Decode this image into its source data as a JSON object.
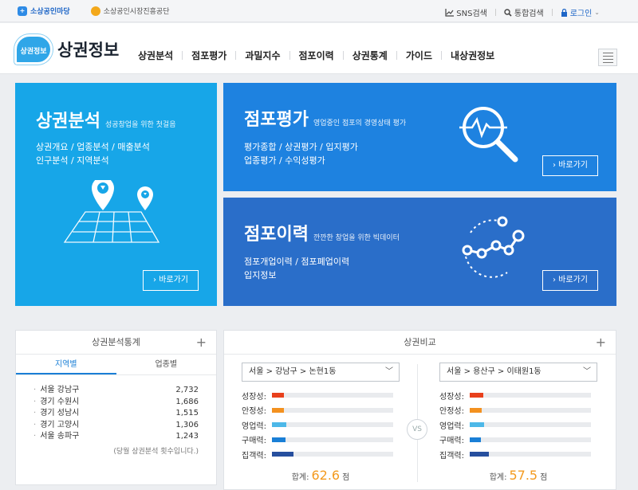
{
  "topbar": {
    "site1": "소상공인마당",
    "site2": "소상공인시장진흥공단",
    "sns": "SNS검색",
    "search": "통합검색",
    "login": "로그인"
  },
  "header": {
    "badge": "상권정보",
    "title": "상권정보",
    "nav": [
      "상권분석",
      "점포평가",
      "과밀지수",
      "점포이력",
      "상권통계",
      "가이드",
      "내상권정보"
    ]
  },
  "cards": {
    "analysis": {
      "title": "상권분석",
      "sub": "성공창업을 위한 첫걸음",
      "line1": "상권개요 / 업종분석 / 매출분석",
      "line2": "인구분석 / 지역분석",
      "go": "› 바로가기"
    },
    "evaluation": {
      "title": "점포평가",
      "sub": "영업중인 점포의 경영상태 평가",
      "line1": "평가종합 / 상권평가 / 입지평가",
      "line2": "업종평가 / 수익성평가",
      "go": "› 바로가기"
    },
    "history": {
      "title": "점포이력",
      "sub": "깐깐한 창업을 위한 빅데이터",
      "line1": "점포개업이력 / 점포폐업이력",
      "line2": "입지정보",
      "go": "› 바로가기"
    }
  },
  "stats": {
    "title": "상권분석통계",
    "plus": "+",
    "tabs": [
      "지역별",
      "업종별"
    ],
    "rows": [
      {
        "name": "서울 강남구",
        "count": "2,732"
      },
      {
        "name": "경기 수원시",
        "count": "1,686"
      },
      {
        "name": "경기 성남시",
        "count": "1,515"
      },
      {
        "name": "경기 고양시",
        "count": "1,306"
      },
      {
        "name": "서울 송파구",
        "count": "1,243"
      }
    ],
    "note": "(당월 상권분석 횟수입니다.)"
  },
  "compare": {
    "title": "상권비교",
    "plus": "+",
    "vs": "VS",
    "metric_labels": [
      "성장성:",
      "안정성:",
      "영업력:",
      "구매력:",
      "집객력:"
    ],
    "metric_colors": [
      "#e8401c",
      "#f3911f",
      "#4db8e8",
      "#1a7fd6",
      "#264f9e"
    ],
    "sum_label": "합계:",
    "unit": "점",
    "left": {
      "region": "서울 > 강남구 > 논현1동",
      "levels": [
        0.1,
        0.1,
        0.12,
        0.11,
        0.18
      ],
      "total": "62.6"
    },
    "right": {
      "region": "서울 > 용산구 > 이태원1동",
      "levels": [
        0.11,
        0.1,
        0.12,
        0.09,
        0.16
      ],
      "total": "57.5"
    }
  }
}
